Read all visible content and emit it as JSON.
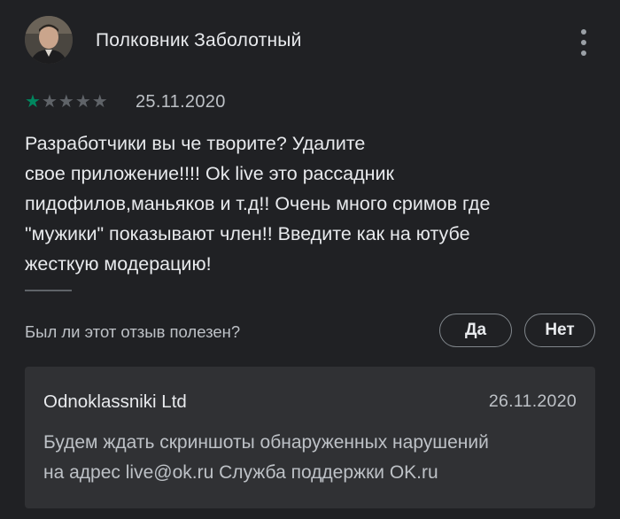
{
  "review": {
    "author": "Полковник Заболотный",
    "rating": 1,
    "max_rating": 5,
    "date": "25.11.2020",
    "text": "Разработчики вы че творите? Удалите\nсвое приложение!!!! Ok live это рассадник\nпидофилов,маньяков и т.д!! Очень много сримов где\n\"мужики\" показывают член!! Введите как на ютубе\nжесткую модерацию!"
  },
  "helpful": {
    "question": "Был ли этот отзыв полезен?",
    "yes_label": "Да",
    "no_label": "Нет"
  },
  "developer_reply": {
    "name": "Odnoklassniki Ltd",
    "date": "26.11.2020",
    "text": "Будем ждать скриншоты обнаруженных нарушений\nна адрес live@ok.ru Служба поддержки OK.ru"
  },
  "icons": {
    "avatar": "avatar",
    "more": "more-vert-icon",
    "star": "star-icon"
  },
  "colors": {
    "background": "#202124",
    "star_active": "#01875f",
    "star_inactive": "#5f6368",
    "reply_background": "#303134"
  }
}
